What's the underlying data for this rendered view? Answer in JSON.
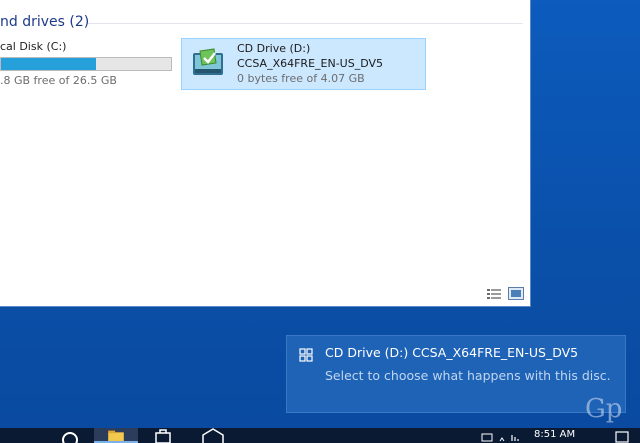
{
  "explorer": {
    "section_title": "nd drives (2)",
    "local_disk": {
      "name": "cal Disk (C:)",
      "free_text": ".8 GB free of 26.5 GB",
      "used_fraction": 0.56
    },
    "cd_drive": {
      "name": "CD Drive (D:)",
      "label": "CCSA_X64FRE_EN-US_DV5",
      "free_text": "0 bytes free of 4.07 GB"
    }
  },
  "toast": {
    "title": "CD Drive (D:) CCSA_X64FRE_EN-US_DV5",
    "body": "Select to choose what happens with this disc."
  },
  "taskbar": {
    "clock": "8:51 AM"
  },
  "watermark": "Gp",
  "colors": {
    "desktop": "#0b57b8",
    "selection": "#cce8ff",
    "progress": "#26a0da",
    "toast": "#1f63b7",
    "taskbar": "#0b1a33"
  }
}
